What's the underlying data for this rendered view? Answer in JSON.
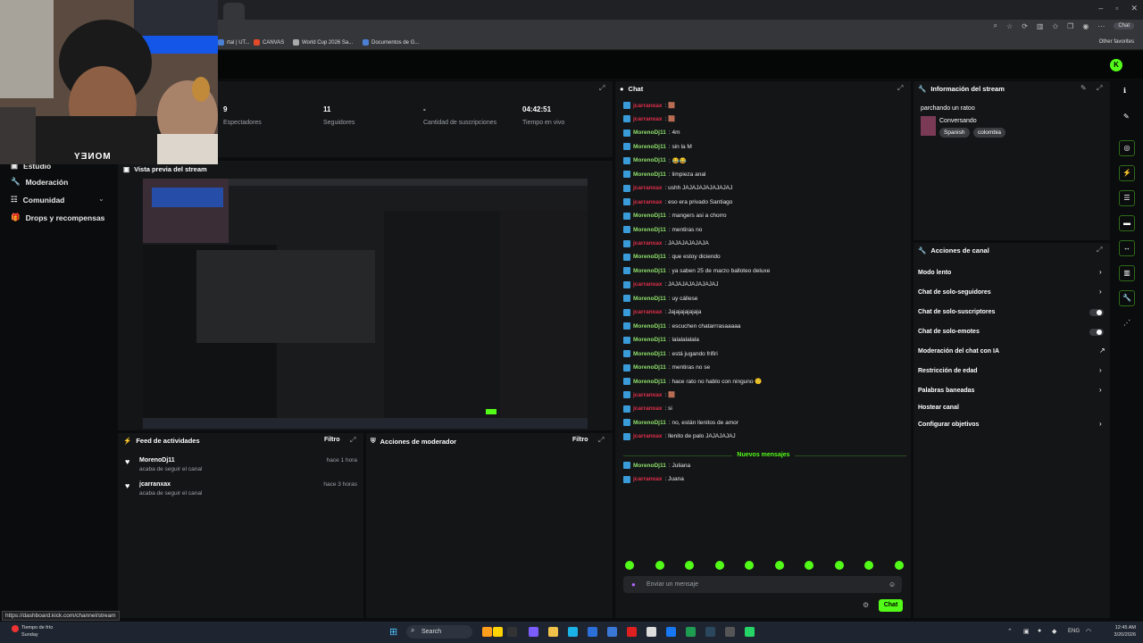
{
  "browser": {
    "bookmarks": [
      {
        "label": "rtal | UT...",
        "color": "#4a7fd4"
      },
      {
        "label": "CANVAS",
        "color": "#e24a2a"
      },
      {
        "label": "World Cup 2026 Sa...",
        "color": "#aaaaaa"
      },
      {
        "label": "Documentos de G...",
        "color": "#4a7fd4"
      }
    ],
    "other_favorites": "Other favorites",
    "chat_pill": "Chat",
    "status_url": "https://dashboard.kick.com/channel/stream"
  },
  "webcam": {
    "shirt_text": "MONEY"
  },
  "nav": {
    "items": [
      {
        "label": "Estudio",
        "icon": "studio-icon"
      },
      {
        "label": "Moderación",
        "icon": "wrench-icon"
      },
      {
        "label": "Comunidad",
        "icon": "community-icon"
      },
      {
        "label": "Drops y recompensas",
        "icon": "drops-icon"
      }
    ]
  },
  "stats": [
    {
      "value": "9",
      "label": "Espectadores"
    },
    {
      "value": "11",
      "label": "Seguidores"
    },
    {
      "value": "-",
      "label": "Cantidad de suscripciones"
    },
    {
      "value": "04:42:51",
      "label": "Tiempo en vivo"
    }
  ],
  "preview": {
    "title": "Vista previa del stream"
  },
  "feed": {
    "title": "Feed de actividades",
    "filter": "Filtro",
    "items": [
      {
        "name": "MorenoDj11",
        "action": "acaba de seguir el canal",
        "time": "hace 1 hora"
      },
      {
        "name": "jcarranxax",
        "action": "acaba de seguir el canal",
        "time": "hace 3 horas"
      }
    ]
  },
  "mod_actions": {
    "title": "Acciones de moderador",
    "filter": "Filtro"
  },
  "chat": {
    "title": "Chat",
    "messages": [
      {
        "user": "jcarranxax",
        "color": "red",
        "text": ": 🟫"
      },
      {
        "user": "jcarranxax",
        "color": "red",
        "text": ": 🟫"
      },
      {
        "user": "MorenoDj11",
        "color": "green",
        "text": ": 4m"
      },
      {
        "user": "MorenoDj11",
        "color": "green",
        "text": ": sin la M"
      },
      {
        "user": "MorenoDj11",
        "color": "green",
        "text": ": 😂😂"
      },
      {
        "user": "MorenoDj11",
        "color": "green",
        "text": ": limpieza anal"
      },
      {
        "user": "jcarranxax",
        "color": "red",
        "text": ": ushh JAJAJAJAJAJAJAJ"
      },
      {
        "user": "jcarranxax",
        "color": "red",
        "text": ": eso era privado Santiago"
      },
      {
        "user": "MorenoDj11",
        "color": "green",
        "text": ": mangers asi a chorro"
      },
      {
        "user": "MorenoDj11",
        "color": "green",
        "text": ": mentiras no"
      },
      {
        "user": "jcarranxax",
        "color": "red",
        "text": ": JAJAJAJAJAJA"
      },
      {
        "user": "MorenoDj11",
        "color": "green",
        "text": ": que estoy diciendo"
      },
      {
        "user": "MorenoDj11",
        "color": "green",
        "text": ": ya saben 25 de marzo balloteo deluxe"
      },
      {
        "user": "jcarranxax",
        "color": "red",
        "text": ": JAJAJAJAJAJAJAJ"
      },
      {
        "user": "MorenoDj11",
        "color": "green",
        "text": ": uy cállese"
      },
      {
        "user": "jcarranxax",
        "color": "red",
        "text": ": Jajajajajajaja"
      },
      {
        "user": "MorenoDj11",
        "color": "green",
        "text": ": escuchen chatarrrasaaaaa"
      },
      {
        "user": "MorenoDj11",
        "color": "green",
        "text": ": lalalalalala"
      },
      {
        "user": "MorenoDj11",
        "color": "green",
        "text": ": está jugando frifiri"
      },
      {
        "user": "MorenoDj11",
        "color": "green",
        "text": ": mentiras no se"
      },
      {
        "user": "MorenoDj11",
        "color": "green",
        "text": ": hace rato no hablo con ninguno 🙂"
      },
      {
        "user": "jcarranxax",
        "color": "red",
        "text": ": 🟫"
      },
      {
        "user": "jcarranxax",
        "color": "red",
        "text": ": si"
      },
      {
        "user": "MorenoDj11",
        "color": "green",
        "text": ": no, están llenitos de amor"
      },
      {
        "user": "jcarranxax",
        "color": "red",
        "text": ": llenito de palo JAJAJAJAJ"
      }
    ],
    "new_messages_label": "Nuevos mensajes",
    "new_messages": [
      {
        "user": "MorenoDj11",
        "color": "green",
        "text": ": Juliana"
      },
      {
        "user": "jcarranxax",
        "color": "red",
        "text": ": Juana"
      }
    ],
    "input_placeholder": "Enviar un mensaje",
    "send_label": "Chat"
  },
  "stream_info": {
    "title": "Información del stream",
    "stream_title": "parchando un ratoo",
    "category": "Conversando",
    "tags": [
      "Spanish",
      "colombia"
    ]
  },
  "channel_actions": {
    "title": "Acciones de canal",
    "items": [
      {
        "label": "Modo lento",
        "control": "caret"
      },
      {
        "label": "Chat de solo-seguidores",
        "control": "caret"
      },
      {
        "label": "Chat de solo-suscriptores",
        "control": "toggle"
      },
      {
        "label": "Chat de solo-emotes",
        "control": "toggle"
      },
      {
        "label": "Moderación del chat con IA",
        "control": "external"
      },
      {
        "label": "Restricción de edad",
        "control": "caret"
      },
      {
        "label": "Palabras baneadas",
        "control": "caret"
      },
      {
        "label": "Hostear canal",
        "control": "none"
      },
      {
        "label": "Configurar objetivos",
        "control": "caret"
      }
    ]
  },
  "taskbar": {
    "weather_line1": "Tiempo de frío",
    "weather_line2": "Sunday",
    "search": "Search",
    "lang": "ENG",
    "time": "12:45 AM",
    "date": "3/20/2026"
  },
  "colors": {
    "accent": "#53fc18",
    "panel": "#141517",
    "bg": "#0b0c0d"
  }
}
